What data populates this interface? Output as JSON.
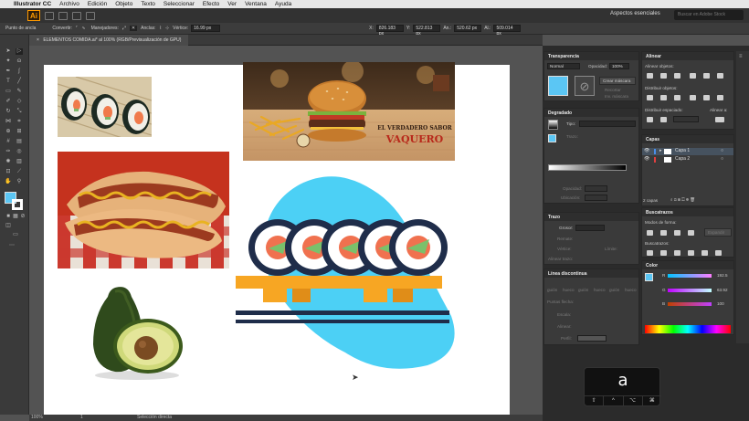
{
  "mac_menu": {
    "app": "Illustrator CC",
    "items": [
      "Archivo",
      "Edición",
      "Objeto",
      "Texto",
      "Seleccionar",
      "Efecto",
      "Ver",
      "Ventana",
      "Ayuda"
    ]
  },
  "appbar": {
    "logo": "Ai",
    "workspace": "Aspectos esenciales",
    "search_placeholder": "Buscar en Adobe Stock"
  },
  "control": {
    "anchor_point": "Punto de ancla",
    "convert": "Convertir:",
    "handles": "Manejadores:",
    "anchors": "Anclas:",
    "vertex": "Vértice:",
    "vertex_value": "16.99 px",
    "x_label": "X:",
    "x_value": "826.183 px",
    "y_label": "Y:",
    "y_value": "522.813 px",
    "w_label": "An.:",
    "w_value": "520.62 px",
    "h_label": "Al.:",
    "h_value": "509.014 px"
  },
  "document": {
    "tab": "ELEMENTOS COMIDA.ai* al 100% (RGB/Previsualización de GPU)",
    "close": "×"
  },
  "status": {
    "zoom": "100%",
    "page": "1",
    "tool": "Selección directa"
  },
  "transparency": {
    "title": "Transparencia",
    "blend": "Normal",
    "opacity_label": "Opacidad:",
    "opacity": "100%",
    "make_mask": "Crear máscara",
    "clip": "Recortar",
    "invert": "Inv. máscara"
  },
  "gradient": {
    "title": "Degradado",
    "type_label": "Tipo:",
    "stroke_label": "Trazo:",
    "opacity_label": "Opacidad:",
    "location_label": "Ubicación:"
  },
  "stroke": {
    "title": "Trazo",
    "weight_label": "Grosor:",
    "cap_label": "Remate:",
    "corner_label": "Vértice:",
    "limit_label": "Límite:",
    "align_label": "Alinear trazo:"
  },
  "dashed": {
    "title": "Línea discontinua",
    "dash_labels": [
      "guión",
      "hueco",
      "guión",
      "hueco",
      "guión",
      "hueco"
    ],
    "arrow_label": "Puntas flecha:",
    "scale_label": "Escala:",
    "align_label": "Alinear:",
    "profile_label": "Perfil:"
  },
  "align": {
    "title": "Alinear",
    "align_objects": "Alinear objetos:",
    "distribute_objects": "Distribuir objetos:",
    "distribute_spacing": "Distribuir espaciado:",
    "align_to": "Alinear a:"
  },
  "layers": {
    "title": "Capas",
    "rows": [
      "Capa 1",
      "Capa 2"
    ],
    "count": "2 capas"
  },
  "pathfinder": {
    "title": "Buscatrazos",
    "shape_modes": "Modos de forma:",
    "expand": "Expandir",
    "pathfinders": "Buscatrazos:"
  },
  "color": {
    "title": "Color",
    "r_label": "R",
    "r_value": "192.5",
    "g_label": "G",
    "g_value": "63.92",
    "b_label": "B",
    "b_value": "100"
  },
  "banner": {
    "line1": "EL VERDADERO SABOR",
    "line2": "VAQUERO"
  },
  "key_overlay": {
    "key": "a",
    "modifiers": [
      "⇧",
      "^",
      "⌥",
      "⌘"
    ]
  },
  "colors": {
    "accent_cyan": "#4cd0f5",
    "mat_orange": "#f7a623",
    "sushi_navy": "#1f2d4a",
    "fill_swatch": "#5bc6f4"
  }
}
